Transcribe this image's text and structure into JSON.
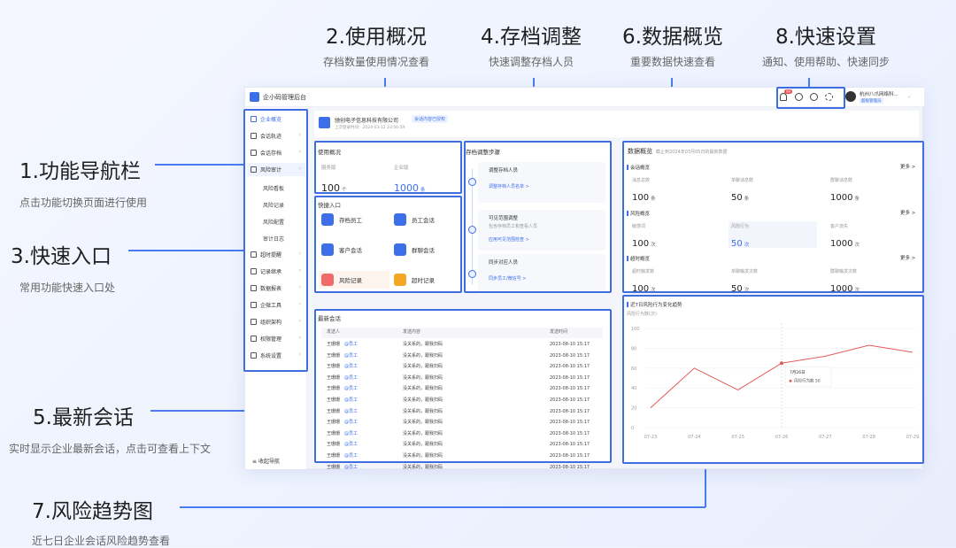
{
  "annotations": {
    "a1": {
      "title": "1.功能导航栏",
      "sub": "点击功能切换页面进行使用"
    },
    "a2": {
      "title": "2.使用概况",
      "sub": "存档数量使用情况查看"
    },
    "a3": {
      "title": "3.快速入口",
      "sub": "常用功能快速入口处"
    },
    "a4": {
      "title": "4.存档调整",
      "sub": "快速调整存档人员"
    },
    "a5": {
      "title": "5.最新会话",
      "sub": "实时显示企业最新会话，点击可查看上下文"
    },
    "a6": {
      "title": "6.数据概览",
      "sub": "重要数据快速查看"
    },
    "a7": {
      "title": "7.风险趋势图",
      "sub": "近七日企业会话风险趋势查看"
    },
    "a8": {
      "title": "8.快速设置",
      "sub": "通知、使用帮助、快速同步"
    }
  },
  "app": {
    "title": "企小码管理后台",
    "user_name": "杭州八爪网络科...",
    "user_role": "超级管理员",
    "notif_badge": "99",
    "colors": {
      "accent": "#3c6fe8",
      "line": "#e55a5a"
    }
  },
  "sidebar": {
    "items": [
      {
        "label": "企业概览",
        "icon": "home-icon",
        "active": true
      },
      {
        "label": "会话轨迹",
        "icon": "list-icon"
      },
      {
        "label": "会话存档",
        "icon": "archive-icon"
      },
      {
        "label": "风险审计",
        "icon": "audit-icon",
        "expanded": true
      },
      {
        "label": "超时提醒",
        "icon": "clock-icon"
      },
      {
        "label": "记录继承",
        "icon": "transfer-icon"
      },
      {
        "label": "数据报表",
        "icon": "chart-icon"
      },
      {
        "label": "企微工具",
        "icon": "tools-icon"
      },
      {
        "label": "组织架构",
        "icon": "org-icon"
      },
      {
        "label": "权限管理",
        "icon": "permission-icon"
      },
      {
        "label": "系统设置",
        "icon": "gear-icon"
      }
    ],
    "sub_items": [
      "风险看板",
      "风险记录",
      "风险配置",
      "审计日志"
    ],
    "collapse_label": "收起导航"
  },
  "company": {
    "name": "驰创电子信息科技有限公司",
    "badge": "会话内容已授权",
    "last_login": "上次登录时间：2024-03-12 23:56:59"
  },
  "usage": {
    "title": "使用概况",
    "service_label": "服务版",
    "service_value": "100",
    "service_unit": "个",
    "enterprise_label": "企业版",
    "enterprise_value": "1000",
    "enterprise_unit": "条"
  },
  "quick": {
    "title": "快捷入口",
    "items": [
      {
        "label": "存档员工",
        "color": "#3c6fe8"
      },
      {
        "label": "员工会话",
        "color": "#3c6fe8"
      },
      {
        "label": "客户会话",
        "color": "#3c6fe8"
      },
      {
        "label": "群聊会话",
        "color": "#3c6fe8"
      },
      {
        "label": "风险记录",
        "color": "#f06a6a"
      },
      {
        "label": "超时记录",
        "color": "#f5a623"
      }
    ]
  },
  "steps": {
    "title": "存档调整步骤",
    "items": [
      {
        "title": "调整存档人员",
        "desc": "",
        "link": "调整存档人员名单 >"
      },
      {
        "title": "可见范围调整",
        "desc": "包含存档员工和查看人员",
        "link": "应用可见范围检查 >"
      },
      {
        "title": "同步对应人员",
        "desc": "",
        "link": "同步员工/微信号 >"
      }
    ]
  },
  "overview": {
    "title": "数据概览",
    "subtitle": "截止到2024年03月05日的最新数据",
    "more": "更多 >",
    "sections": [
      {
        "title": "会话概览",
        "metrics": [
          {
            "label": "消息总数",
            "value": "100",
            "unit": "条"
          },
          {
            "label": "单聊消息数",
            "value": "50",
            "unit": "条"
          },
          {
            "label": "群聊消息数",
            "value": "1000",
            "unit": "条"
          }
        ]
      },
      {
        "title": "风险概览",
        "metrics": [
          {
            "label": "敏感词",
            "value": "100",
            "unit": "次"
          },
          {
            "label": "风险行为",
            "value": "50",
            "unit": "次",
            "highlight": true
          },
          {
            "label": "客户流失",
            "value": "1000",
            "unit": "次"
          }
        ]
      },
      {
        "title": "超时概览",
        "metrics": [
          {
            "label": "超时触发数",
            "value": "100",
            "unit": "次"
          },
          {
            "label": "单聊触发次数",
            "value": "50",
            "unit": "次"
          },
          {
            "label": "群聊触发次数",
            "value": "1000",
            "unit": "次"
          }
        ]
      }
    ]
  },
  "latest": {
    "title": "最新会话",
    "headers": [
      "发送人",
      "发送内容",
      "发送时间"
    ],
    "rows": [
      {
        "sender": "王珊珊",
        "tag": "@员工",
        "content": "没关系的，跟我扫码",
        "time": "2023-08-10 15:17"
      },
      {
        "sender": "王珊珊",
        "tag": "@员工",
        "content": "没关系的，跟我扫码",
        "time": "2023-08-10 15:17"
      },
      {
        "sender": "王珊珊",
        "tag": "@员工",
        "content": "没关系的，跟我扫码",
        "time": "2023-08-10 15:17"
      },
      {
        "sender": "王珊珊",
        "tag": "@员工",
        "content": "没关系的，跟我扫码",
        "time": "2023-08-10 15:17"
      },
      {
        "sender": "王珊珊",
        "tag": "@员工",
        "content": "没关系的，跟我扫码",
        "time": "2023-08-10 15:17"
      },
      {
        "sender": "王珊珊",
        "tag": "@员工",
        "content": "没关系的，跟我扫码",
        "time": "2023-08-10 15:17"
      },
      {
        "sender": "王珊珊",
        "tag": "@员工",
        "content": "没关系的，跟我扫码",
        "time": "2023-08-10 15:17"
      },
      {
        "sender": "王珊珊",
        "tag": "@员工",
        "content": "没关系的，跟我扫码",
        "time": "2023-08-10 15:17"
      },
      {
        "sender": "王珊珊",
        "tag": "@员工",
        "content": "没关系的，跟我扫码",
        "time": "2023-08-10 15:17"
      },
      {
        "sender": "王珊珊",
        "tag": "@员工",
        "content": "没关系的，跟我扫码",
        "time": "2023-08-10 15:17"
      },
      {
        "sender": "王珊珊",
        "tag": "@员工",
        "content": "没关系的，跟我扫码",
        "time": "2023-08-10 15:17"
      },
      {
        "sender": "王珊珊",
        "tag": "@员工",
        "content": "没关系的，跟我扫码",
        "time": "2023-08-10 15:17"
      }
    ]
  },
  "chart_data": {
    "type": "line",
    "title": "近7日风险行为变化趋势",
    "ylabel": "风险行为数(次)",
    "x": [
      "07-23",
      "07-24",
      "07-25",
      "07-26",
      "07-27",
      "07-28",
      "07-29"
    ],
    "series": [
      {
        "name": "风险行为数",
        "values": [
          20,
          60,
          38,
          65,
          72,
          83,
          76
        ]
      }
    ],
    "ylim": [
      0,
      100
    ],
    "yticks": [
      0,
      20,
      40,
      60,
      80,
      100
    ],
    "tooltip": {
      "date": "7月26日",
      "label": "风险行为数",
      "value": "50"
    },
    "grid": true
  }
}
